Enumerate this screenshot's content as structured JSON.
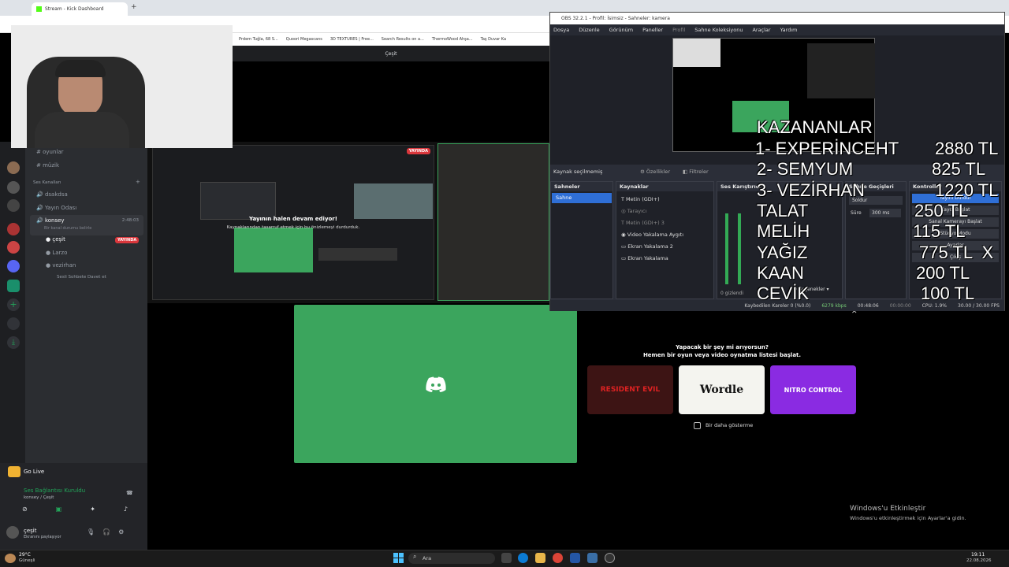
{
  "browser": {
    "tab_active": "Stream - Kick Dashboard",
    "bookmarks": [
      "Prdem Tuğla, 68 S...",
      "Quoori Megascans",
      "3D TEXTURES | Free...",
      "Search Results on a...",
      "ThermoWood Ahşa...",
      "Taş Duvar Ka"
    ]
  },
  "discord": {
    "channel_header": "Çeşit",
    "text_channels": [
      "oyunlar",
      "müzik"
    ],
    "voice_section": "Ses Kanalları",
    "voice_channels": [
      "dsakdsa",
      "Yayın Odası",
      "konsey"
    ],
    "konsey_timer": "2:48:03",
    "konsey_status": "Bir kanal durumu belirle",
    "voice_users": [
      "çeşit",
      "Larzo",
      "vezirhan"
    ],
    "live_label": "YAYINDA",
    "invite_text": "Sesli Sohbete Davet et",
    "go_live": "Go Live",
    "voice_connected": "Ses Bağlantısı Kuruldu",
    "voice_location": "konsey / Çeşit",
    "username": "çeşit",
    "user_status": "Ekranını paylaşıyor",
    "stream_paused_title": "Yayının halen devam ediyor!",
    "stream_paused_sub": "Kaynaklarından tasarruf etmek için bu önizlemeyi durdurduk.",
    "activity_q": "Yapacak bir şey mi arıyorsun?",
    "activity_sub": "Hemen bir oyun veya video oynatma listesi başlat.",
    "activity_cards": [
      "RESIDENT EVIL",
      "Wordle",
      "NITRO CONTROL"
    ],
    "dont_show": "Bir daha gösterme"
  },
  "obs": {
    "title": "OBS 32.2.1 - Profil: İsimsiz - Sahneler: kamera",
    "menu": [
      "Dosya",
      "Düzenle",
      "Görünüm",
      "Paneller",
      "Profil",
      "Sahne Koleksiyonu",
      "Araçlar",
      "Yardım"
    ],
    "no_source": "Kaynak seçilmemiş",
    "props": "Özellikler",
    "filters": "Filtreler",
    "docks": [
      "Sahneler",
      "Kaynaklar",
      "Ses Karıştırıcı",
      "Sahne Geçişleri",
      "Kontroller"
    ],
    "scene": "Sahne",
    "sources": [
      "Metin (GDI+)",
      "Tarayıcı",
      "Metin (GDI+) 3",
      "Video Yakalama Aygıtı",
      "Ekran Yakalama 2",
      "Ekran Yakalama"
    ],
    "transition": "Soldur",
    "duration_label": "Süre",
    "duration": "300 ms",
    "controls": [
      "Yayını Durdur",
      "Kaydı Başlat",
      "Sanal Kamerayı Başlat",
      "Stüdyo Modu",
      "Ayarlar",
      "Çıkış"
    ],
    "status": [
      "Kaybedilen Kareler 0 (%0.0)",
      "6279 kbps",
      "00:48:06",
      "00:00:00",
      "CPU: 1.9%",
      "30.00 / 30.00 FPS"
    ],
    "hidden": "0 gizlendi",
    "options": "Seçenekler"
  },
  "overlay": {
    "title": "KAZANANLAR",
    "rows": [
      {
        "name": "1- EXPERİNCEHT",
        "amount": "2880 TL"
      },
      {
        "name": "2- SEMYUM",
        "amount": "825 TL"
      },
      {
        "name": "3- VEZİRHAN",
        "amount": "1220 TL"
      },
      {
        "name": "TALAT",
        "amount": "250 TL"
      },
      {
        "name": "MELİH",
        "amount": "115 TL"
      },
      {
        "name": "YAĞIZ",
        "amount": "775 TL  X"
      },
      {
        "name": "KAAN",
        "amount": "200 TL"
      },
      {
        "name": "CEVİK",
        "amount": "100 TL"
      }
    ]
  },
  "windows": {
    "activate_title": "Windows'u Etkinleştir",
    "activate_sub": "Windows'u etkinleştirmek için Ayarlar'a gidin.",
    "weather_temp": "29°C",
    "weather_text": "Güneşli",
    "search": "Ara",
    "clock": "19:11",
    "date": "22.08.2026"
  }
}
